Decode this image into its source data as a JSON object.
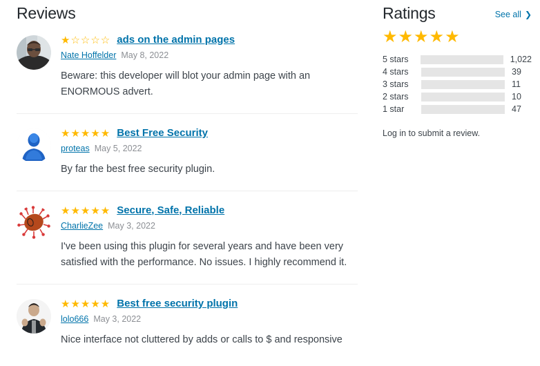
{
  "reviews_section": {
    "title": "Reviews",
    "items": [
      {
        "id": "review-1",
        "stars_filled": 1,
        "stars_total": 5,
        "title": "ads on the admin pages",
        "author": "Nate Hoffelder",
        "date": "May 8, 2022",
        "text": "Beware: this developer will blot your admin page with an ENORMOUS advert.",
        "avatar": "photo-man-glasses"
      },
      {
        "id": "review-2",
        "stars_filled": 5,
        "stars_total": 5,
        "title": "Best Free Security",
        "author": "proteas",
        "date": "May 5, 2022",
        "text": "By far the best free security plugin.",
        "avatar": "blue-mystery-person"
      },
      {
        "id": "review-3",
        "stars_filled": 5,
        "stars_total": 5,
        "title": "Secure, Safe, Reliable",
        "author": "CharlieZee",
        "date": "May 3, 2022",
        "text": "I've been using this plugin for several years and have been very satisfied with the performance. No issues. I highly recommend it.",
        "avatar": "orange-germ-cartoon"
      },
      {
        "id": "review-4",
        "stars_filled": 5,
        "stars_total": 5,
        "title": "Best free security plugin",
        "author": "lolo666",
        "date": "May 3, 2022",
        "text": "Nice interface not cluttered by adds or calls to $ and responsive",
        "avatar": "photo-person-dark-jacket"
      }
    ]
  },
  "ratings_section": {
    "title": "Ratings",
    "see_all_label": "See all",
    "see_all_icon": "chevron-right-icon",
    "overall_stars": 5,
    "overall_stars_total": 5,
    "breakdown": [
      {
        "label": "5 stars",
        "count": "1,022",
        "value": 1022,
        "fill_percent": 91
      },
      {
        "label": "4 stars",
        "count": "39",
        "value": 39,
        "fill_percent": 6
      },
      {
        "label": "3 stars",
        "count": "11",
        "value": 11,
        "fill_percent": 2
      },
      {
        "label": "2 stars",
        "count": "10",
        "value": 10,
        "fill_percent": 2
      },
      {
        "label": "1 star",
        "count": "47",
        "value": 47,
        "fill_percent": 7
      }
    ],
    "login_note": "Log in to submit a review."
  },
  "colors": {
    "star": "#ffb900",
    "bar_fill": "#ffc733",
    "bar_track": "#e5e5e5",
    "link": "#0073aa",
    "text": "#3c434a",
    "muted": "#8c8f94"
  }
}
